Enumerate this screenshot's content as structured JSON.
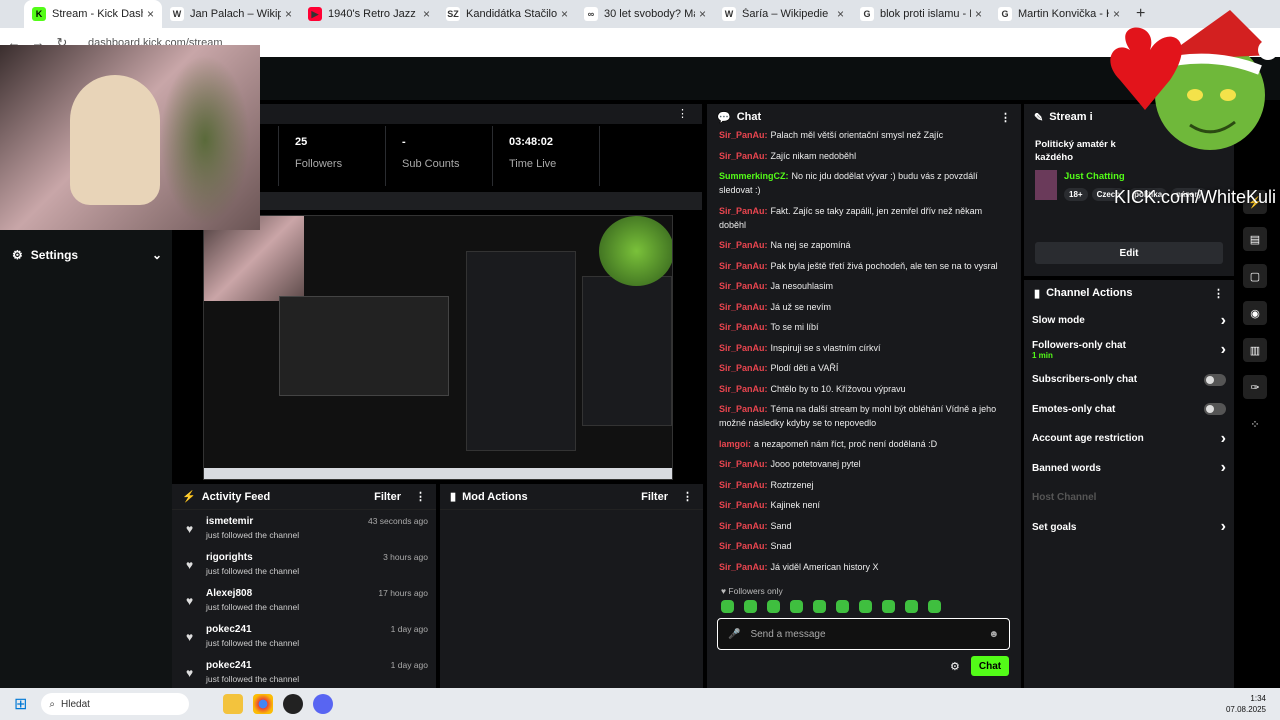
{
  "browser": {
    "tabs": [
      {
        "title": "Stream - Kick Dashboard",
        "fav": "K",
        "color": "#53fc18"
      },
      {
        "title": "Jan Palach – Wikipedie",
        "fav": "W",
        "color": "#ffffff"
      },
      {
        "title": "1940's Retro Jazz - Vi",
        "fav": "▶",
        "color": "#ff0033"
      },
      {
        "title": "Kandidátka Stačilo! histo",
        "fav": "SZ",
        "color": "#ffffff"
      },
      {
        "title": "30 let svobody? Máme na",
        "fav": "∞",
        "color": "#ffffff"
      },
      {
        "title": "Šaría – Wikipedie",
        "fav": "W",
        "color": "#ffffff"
      },
      {
        "title": "blok proti islamu - Hleda",
        "fav": "G",
        "color": "#ffffff"
      },
      {
        "title": "Martin Konvička - Hledat",
        "fav": "G",
        "color": "#ffffff"
      }
    ],
    "url": "dashboard.kick.com/stream"
  },
  "sidebar": {
    "settings_label": "Settings"
  },
  "stats": [
    {
      "value": "-",
      "label": "Viewers"
    },
    {
      "value": "25",
      "label": "Followers"
    },
    {
      "value": "-",
      "label": "Sub Counts"
    },
    {
      "value": "03:48:02",
      "label": "Time Live"
    }
  ],
  "activity": {
    "title": "Activity Feed",
    "filter": "Filter",
    "events": [
      {
        "name": "ismetemir",
        "action": "just followed the channel",
        "time": "43 seconds ago"
      },
      {
        "name": "rigorights",
        "action": "just followed the channel",
        "time": "3 hours ago"
      },
      {
        "name": "Alexej808",
        "action": "just followed the channel",
        "time": "17 hours ago"
      },
      {
        "name": "pokec241",
        "action": "just followed the channel",
        "time": "1 day ago"
      },
      {
        "name": "pokec241",
        "action": "just followed the channel",
        "time": "1 day ago"
      }
    ]
  },
  "mod_actions": {
    "title": "Mod Actions",
    "filter": "Filter"
  },
  "chat": {
    "title": "Chat",
    "messages": [
      {
        "user": "Sir_PanAu:",
        "color": "#e8454f",
        "text": "Palach měl větší orientační smysl než Zajíc"
      },
      {
        "user": "Sir_PanAu:",
        "color": "#e8454f",
        "text": "Zajíc nikam nedoběhl"
      },
      {
        "user": "SummerkingCZ:",
        "color": "#53fc18",
        "text": "No nic jdu dodělat vývar :) budu vás z povzdálí sledovat :)"
      },
      {
        "user": "Sir_PanAu:",
        "color": "#e8454f",
        "text": "Fakt. Zajíc se taky zapálil, jen zemřel dřív než někam doběhl"
      },
      {
        "user": "Sir_PanAu:",
        "color": "#e8454f",
        "text": "Na nej se zapomíná"
      },
      {
        "user": "Sir_PanAu:",
        "color": "#e8454f",
        "text": "Pak byla ještě třetí živá pochodeň, ale ten se na to vysral"
      },
      {
        "user": "Sir_PanAu:",
        "color": "#e8454f",
        "text": "Ja nesouhlasim"
      },
      {
        "user": "Sir_PanAu:",
        "color": "#e8454f",
        "text": "Já už se nevím"
      },
      {
        "user": "Sir_PanAu:",
        "color": "#e8454f",
        "text": "To se mi líbí"
      },
      {
        "user": "Sir_PanAu:",
        "color": "#e8454f",
        "text": "Inspiruji se s vlastním církví"
      },
      {
        "user": "Sir_PanAu:",
        "color": "#e8454f",
        "text": "Plodí děti a VAŘÍ"
      },
      {
        "user": "Sir_PanAu:",
        "color": "#e8454f",
        "text": "Chtělo by to 10. Křížovou výpravu"
      },
      {
        "user": "Sir_PanAu:",
        "color": "#e8454f",
        "text": "Téma na další stream by mohl být obléhání Vídně a jeho možné následky kdyby se to nepovedlo"
      },
      {
        "user": "lamgoi:",
        "color": "#e8454f",
        "text": "a nezapomeň nám říct, proč není dodělaná :D"
      },
      {
        "user": "Sir_PanAu:",
        "color": "#e8454f",
        "text": "Jooo potetovanej pytel"
      },
      {
        "user": "Sir_PanAu:",
        "color": "#e8454f",
        "text": "Roztrzenej"
      },
      {
        "user": "Sir_PanAu:",
        "color": "#e8454f",
        "text": "Kajinek není"
      },
      {
        "user": "Sir_PanAu:",
        "color": "#e8454f",
        "text": "Sand"
      },
      {
        "user": "Sir_PanAu:",
        "color": "#e8454f",
        "text": "Snad"
      },
      {
        "user": "Sir_PanAu:",
        "color": "#e8454f",
        "text": "Já viděl American history X"
      }
    ],
    "followers_only": "Followers only",
    "placeholder": "Send a message",
    "send_label": "Chat"
  },
  "stream_info": {
    "title": "Stream i",
    "stream_title": "Politický amatér k každého",
    "category": "Just Chatting",
    "tags": [
      "18+",
      "Czech",
      "politika",
      "názory"
    ],
    "edit_label": "Edit"
  },
  "channel_actions": {
    "title": "Channel Actions",
    "rows": [
      {
        "label": "Slow mode",
        "sub": "",
        "control": "chevron"
      },
      {
        "label": "Followers-only chat",
        "sub": "1 min",
        "control": "chevron"
      },
      {
        "label": "Subscribers-only chat",
        "sub": "",
        "control": "toggle"
      },
      {
        "label": "Emotes-only chat",
        "sub": "",
        "control": "toggle"
      },
      {
        "label": "Account age restriction",
        "sub": "",
        "control": "chevron"
      },
      {
        "label": "Banned words",
        "sub": "",
        "control": "chevron"
      },
      {
        "label": "Host Channel",
        "sub": "",
        "control": "disabled"
      },
      {
        "label": "Set goals",
        "sub": "",
        "control": "chevron"
      }
    ]
  },
  "watermark": "KICK.com/WhiteKuli",
  "taskbar": {
    "search_placeholder": "Hledat",
    "time": "1:34",
    "date": "07.08.2025"
  }
}
